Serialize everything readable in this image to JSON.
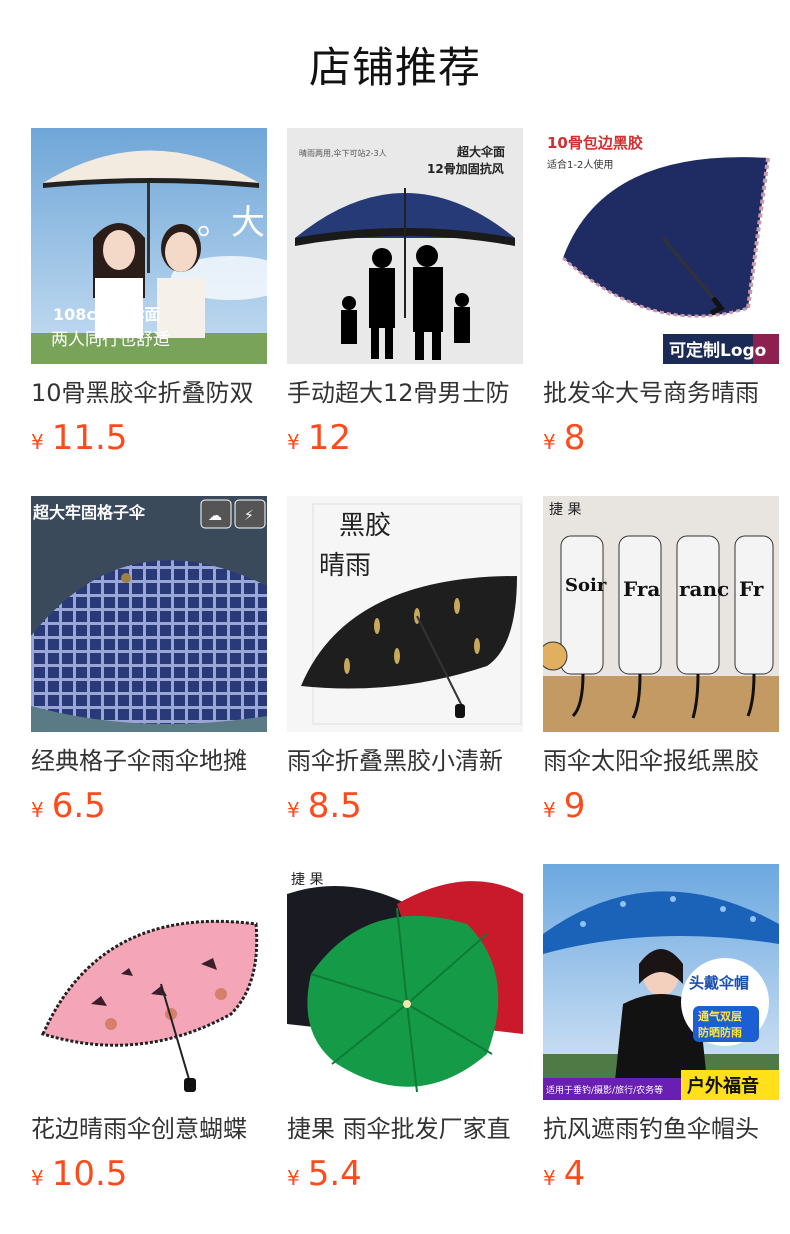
{
  "header": {
    "title": "店铺推荐"
  },
  "currency": "¥",
  "products": [
    {
      "name": "10骨黑胶伞折叠防双",
      "price": "11.5",
      "image_texts": [
        "108cm大伞面",
        "两人同行也舒适",
        "。大"
      ]
    },
    {
      "name": "手动超大12骨男士防",
      "price": "12",
      "image_texts": [
        "晴雨两用,伞下可站2-3人",
        "超大伞面",
        "12骨加固抗风"
      ]
    },
    {
      "name": "批发伞大号商务晴雨",
      "price": "8",
      "image_texts": [
        "10骨包边黑胶",
        "适合1-2人使用",
        "可定制Logo"
      ]
    },
    {
      "name": "经典格子伞雨伞地摊",
      "price": "6.5",
      "image_texts": [
        "超大牢固格子伞"
      ]
    },
    {
      "name": "雨伞折叠黑胶小清新",
      "price": "8.5",
      "image_texts": [
        "黑胶",
        "晴雨"
      ]
    },
    {
      "name": "雨伞太阳伞报纸黑胶",
      "price": "9",
      "image_texts": [
        "捷 果"
      ]
    },
    {
      "name": "花边晴雨伞创意蝴蝶",
      "price": "10.5",
      "image_texts": []
    },
    {
      "name": "捷果 雨伞批发厂家直",
      "price": "5.4",
      "image_texts": [
        "捷 果"
      ]
    },
    {
      "name": "抗风遮雨钓鱼伞帽头",
      "price": "4",
      "image_texts": [
        "头戴伞帽",
        "通气双层",
        "防晒防雨",
        "适用于垂钓/摄影/旅行/农务等",
        "户外福音"
      ]
    }
  ]
}
